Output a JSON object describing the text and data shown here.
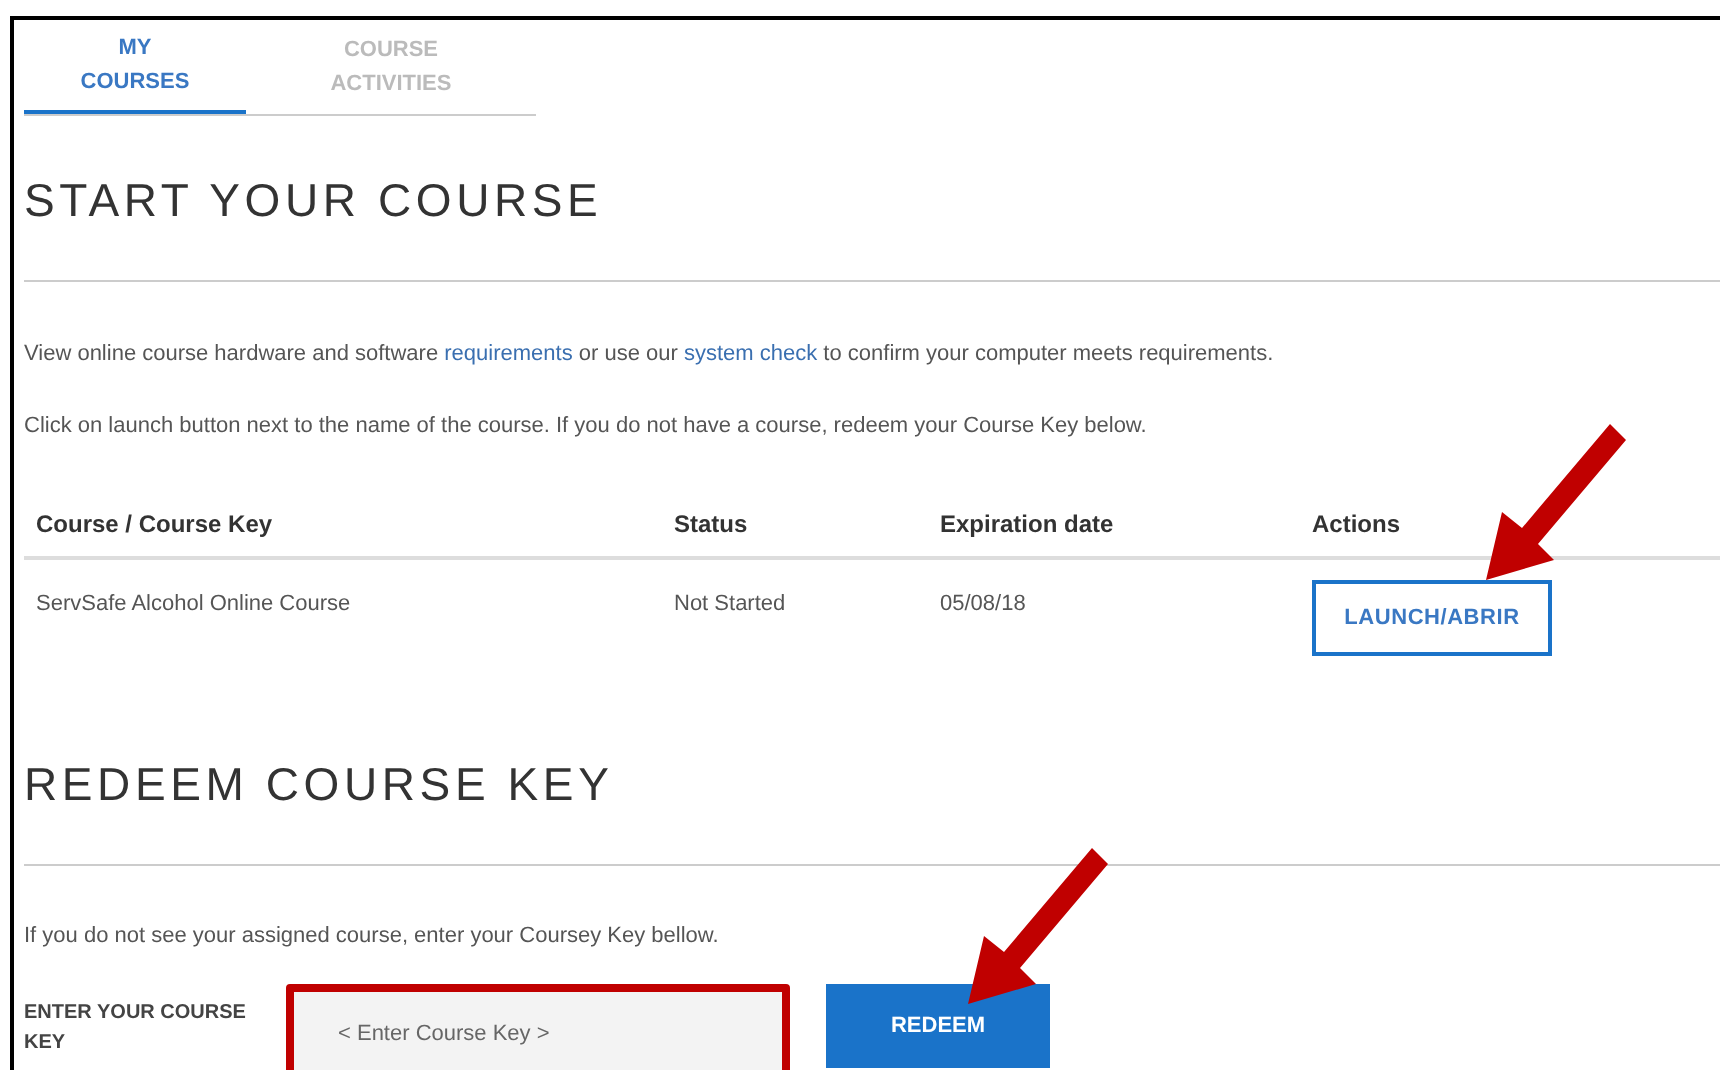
{
  "tabs": [
    {
      "label": "MY COURSES",
      "selected": true
    },
    {
      "label": "COURSE ACTIVITIES",
      "selected": false
    }
  ],
  "start_section": {
    "title": "START YOUR COURSE",
    "intro": [
      {
        "kind": "text",
        "text": "View online course hardware and software "
      },
      {
        "kind": "link",
        "text": "requirements"
      },
      {
        "kind": "text",
        "text": " or use our "
      },
      {
        "kind": "link",
        "text": "system check"
      },
      {
        "kind": "text",
        "text": " to confirm your computer meets requirements."
      }
    ],
    "instructions": "Click on launch button next to the name of the course. If you do not have a course, redeem your Course Key below.",
    "table": {
      "columns": [
        "Course / Course Key",
        "Status",
        "Expiration date",
        "Actions"
      ],
      "rows": [
        {
          "course": "ServSafe Alcohol Online Course",
          "status": "Not Started",
          "expiration": "05/08/18",
          "action": "LAUNCH/ABRIR"
        }
      ]
    }
  },
  "redeem_section": {
    "title": "REDEEM COURSE KEY",
    "instructions": "If you do not see your assigned course, enter your Coursey Key bellow.",
    "field_label": "ENTER YOUR COURSE KEY",
    "placeholder": "< Enter Course Key >",
    "button": "REDEEM"
  }
}
